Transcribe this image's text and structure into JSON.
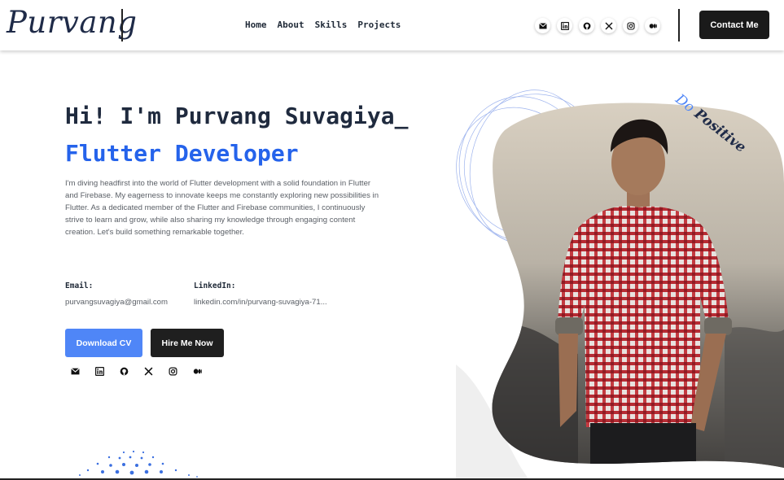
{
  "brand": {
    "logo": "Purvang"
  },
  "nav": {
    "items": [
      "Home",
      "About",
      "Skills",
      "Projects"
    ]
  },
  "social_icons": [
    "mail-icon",
    "linkedin-icon",
    "github-icon",
    "x-icon",
    "instagram-icon",
    "medium-icon"
  ],
  "header": {
    "contact_label": "Contact Me"
  },
  "hero": {
    "greeting": "Hi! I'm Purvang Suvagiya_",
    "role": "Flutter Developer",
    "bio": "I'm diving headfirst into the world of Flutter development with a solid foundation in Flutter and Firebase. My eagerness to innovate keeps me constantly exploring new possibilities in Flutter. As a dedicated member of the Flutter and Firebase communities, I continuously strive to learn and grow, while also sharing my knowledge through engaging content creation. Let's build something remarkable together.",
    "email_label": "Email:",
    "email_value": "purvangsuvagiya@gmail.com",
    "linkedin_label": "LinkedIn:",
    "linkedin_value": "linkedin.com/in/purvang-suvagiya-71...",
    "download_cv_label": "Download CV",
    "hire_label": "Hire Me Now"
  },
  "tagline": {
    "first": "Do",
    "second": "Positive"
  },
  "colors": {
    "accent": "#2563eb",
    "button_blue": "#4f86f7",
    "dark": "#1f1f1f",
    "text": "#1f2a3e"
  }
}
